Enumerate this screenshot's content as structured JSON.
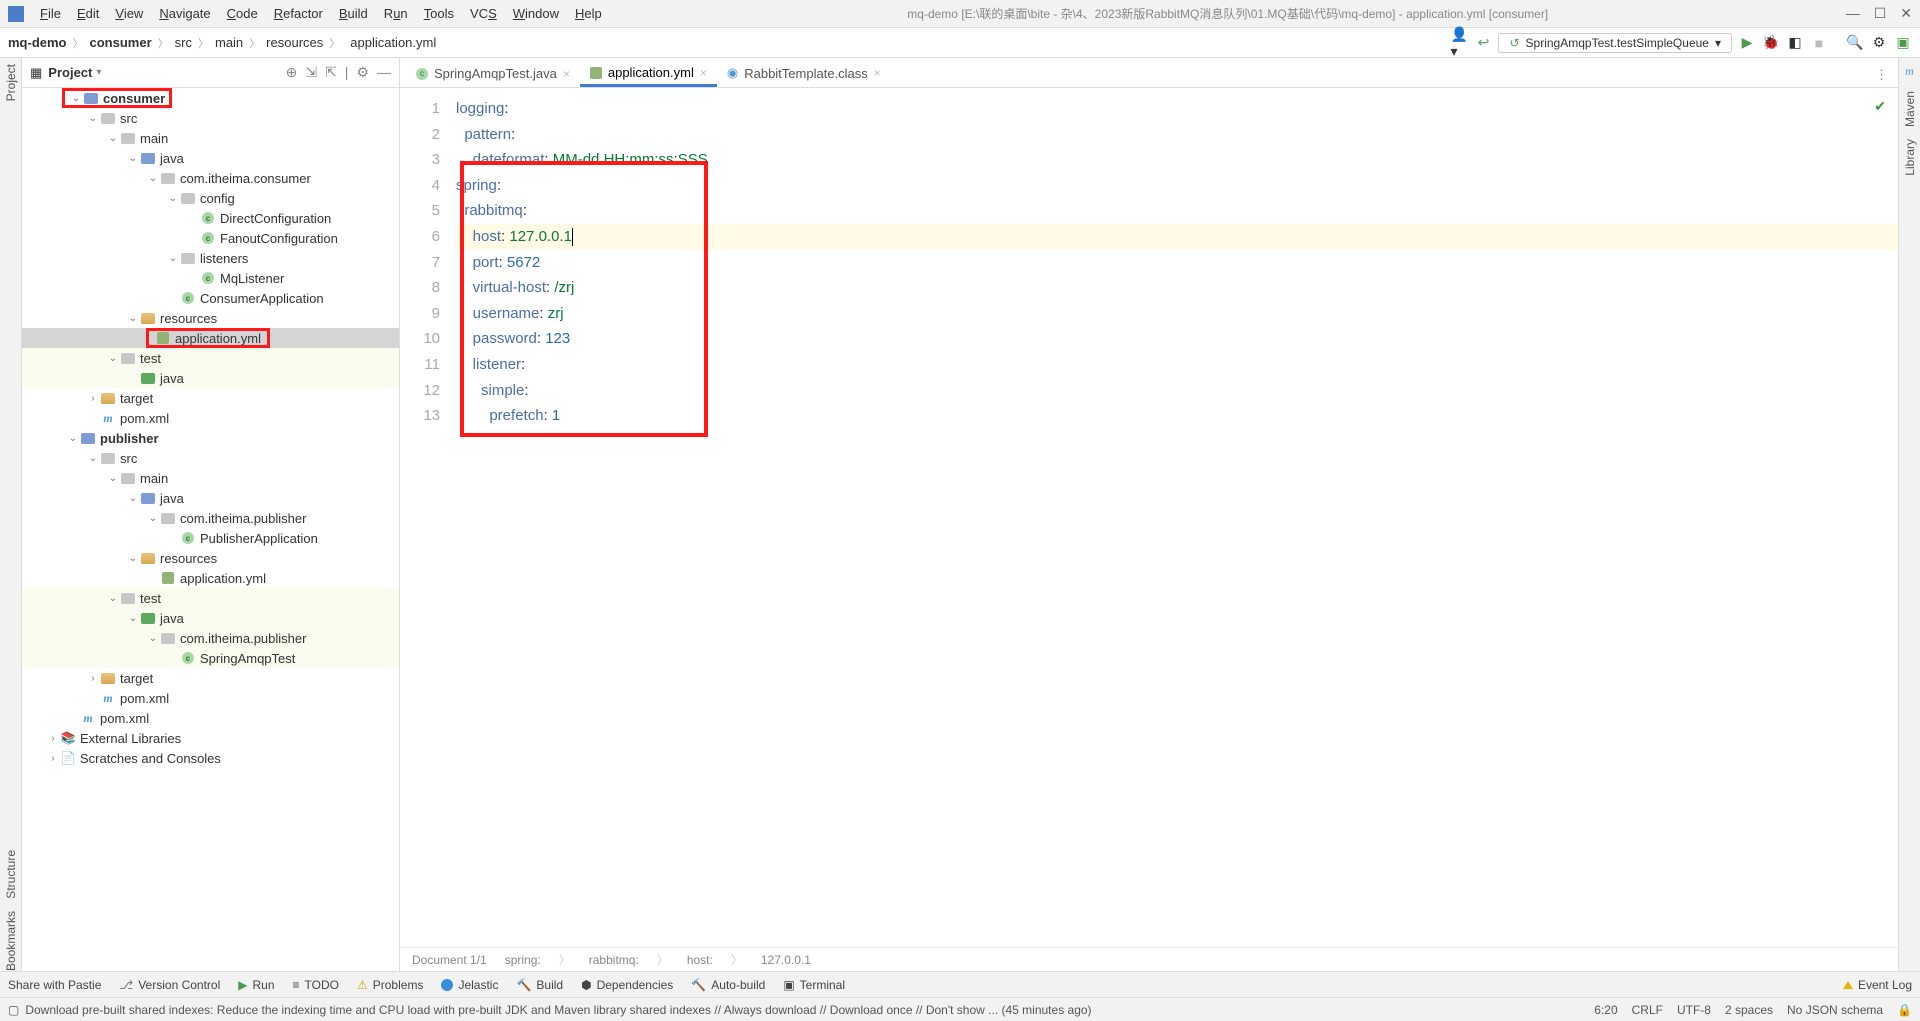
{
  "window": {
    "title": "mq-demo [E:\\联的桌面\\bite - 杂\\4、2023新版RabbitMQ消息队列\\01.MQ基础\\代码\\mq-demo] - application.yml [consumer]"
  },
  "menu": {
    "file": "File",
    "edit": "Edit",
    "view": "View",
    "navigate": "Navigate",
    "code": "Code",
    "refactor": "Refactor",
    "build": "Build",
    "run": "Run",
    "tools": "Tools",
    "vcs": "VCS",
    "window": "Window",
    "help": "Help"
  },
  "breadcrumb": {
    "p0": "mq-demo",
    "p1": "consumer",
    "p2": "src",
    "p3": "main",
    "p4": "resources",
    "p5": "application.yml"
  },
  "run_config": "SpringAmqpTest.testSimpleQueue",
  "project_panel": {
    "title": "Project"
  },
  "tree": {
    "consumer": "consumer",
    "src": "src",
    "main": "main",
    "java": "java",
    "pkg_consumer": "com.itheima.consumer",
    "config": "config",
    "direct_cfg": "DirectConfiguration",
    "fanout_cfg": "FanoutConfiguration",
    "listeners": "listeners",
    "mq_listener": "MqListener",
    "consumer_app": "ConsumerApplication",
    "resources": "resources",
    "application_yml": "application.yml",
    "test": "test",
    "target": "target",
    "pom": "pom.xml",
    "publisher": "publisher",
    "pkg_publisher": "com.itheima.publisher",
    "publisher_app": "PublisherApplication",
    "spring_amqp_test": "SpringAmqpTest",
    "ext_libs": "External Libraries",
    "scratches": "Scratches and Consoles"
  },
  "tabs": {
    "t0": "SpringAmqpTest.java",
    "t1": "application.yml",
    "t2": "RabbitTemplate.class"
  },
  "editor": {
    "l1a": "logging",
    "l1b": ":",
    "l2a": "pattern",
    "l2b": ":",
    "l3a": "dateformat",
    "l3b": ": ",
    "l3c": "MM-dd HH:mm:ss:SSS",
    "l4a": "spring",
    "l4b": ":",
    "l5a": "rabbitmq",
    "l5b": ":",
    "l6a": "host",
    "l6b": ": ",
    "l6c": "127.0.0.1",
    "l7a": "port",
    "l7b": ": ",
    "l7c": "5672",
    "l8a": "virtual-host",
    "l8b": ": ",
    "l8c": "/zrj",
    "l9a": "username",
    "l9b": ": ",
    "l9c": "zrj",
    "l10a": "password",
    "l10b": ": ",
    "l10c": "123",
    "l11a": "listener",
    "l11b": ":",
    "l12a": "simple",
    "l12b": ":",
    "l13a": "prefetch",
    "l13b": ": ",
    "l13c": "1",
    "ln1": "1",
    "ln2": "2",
    "ln3": "3",
    "ln4": "4",
    "ln5": "5",
    "ln6": "6",
    "ln7": "7",
    "ln8": "8",
    "ln9": "9",
    "ln10": "10",
    "ln11": "11",
    "ln12": "12",
    "ln13": "13"
  },
  "editor_breadcrumb": {
    "doc": "Document 1/1",
    "p0": "spring:",
    "p1": "rabbitmq:",
    "p2": "host:",
    "p3": "127.0.0.1"
  },
  "toolstrip": {
    "share": "Share with Pastie",
    "vc": "Version Control",
    "run": "Run",
    "todo": "TODO",
    "problems": "Problems",
    "jelastic": "Jelastic",
    "build": "Build",
    "deps": "Dependencies",
    "autobuild": "Auto-build",
    "terminal": "Terminal",
    "eventlog": "Event Log"
  },
  "status": {
    "msg": "Download pre-built shared indexes: Reduce the indexing time and CPU load with pre-built JDK and Maven library shared indexes // Always download // Download once // Don't show ... (45 minutes ago)",
    "pos": "6:20",
    "crlf": "CRLF",
    "enc": "UTF-8",
    "indent": "2 spaces",
    "schema": "No JSON schema"
  },
  "rails": {
    "project": "Project",
    "structure": "Structure",
    "bookmarks": "Bookmarks",
    "maven": "Maven",
    "library": "Library"
  }
}
